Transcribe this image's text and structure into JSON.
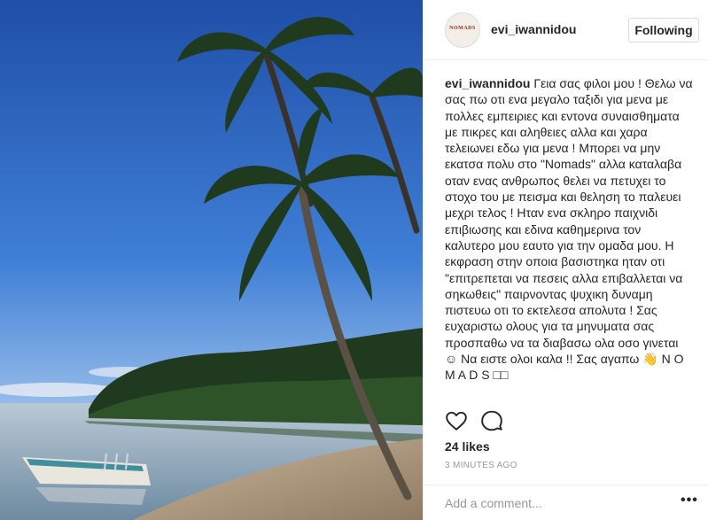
{
  "header": {
    "avatar_text": "NOMADS",
    "username": "evi_iwannidou",
    "follow_label": "Following"
  },
  "caption": {
    "username": "evi_iwannidou",
    "text": "Γεια σας φιλοι μου ! Θελω να σας πω οτι ενα μεγαλο ταξιδι για μενα με πολλες εμπειριες και εντονα συναισθηματα με πικρες και αληθειες αλλα και χαρα τελειωνει εδω για μενα ! Μπορει να μην εκατσα πολυ στο \"Nomads\" αλλα καταλαβα οταν ενας ανθρωπος θελει να πετυχει το στοχο του με πεισμα και θεληση το παλευει μεχρι τελος ! Ηταν ενα σκληρο παιχνιδι επιβιωσης και εδινα καθημερινα τον καλυτερο μου εαυτο για την ομαδα μου. Η εκφραση στην οποια βασιστηκα ηταν οτι \"επιτρεπεται να πεσεις αλλα επιβαλλεται να σηκωθεις\" παιρνοντας ψυχικη δυναμη πιστευω οτι το εκτελεσα απολυτα ! Σας ευχαριστω ολους για τα μηνυματα σας προσπαθω να τα διαβασω ολα οσο γινεται ☺ Να ειστε ολοι καλα !! Σας αγαπω 👋 N O M A D S □□"
  },
  "actions": {
    "like_icon": "heart-outline-icon",
    "comment_icon": "comment-bubble-icon"
  },
  "likes": "24 likes",
  "timestamp": "3 MINUTES AGO",
  "comment": {
    "placeholder": "Add a comment...",
    "more_label": "•••"
  },
  "colors": {
    "sky": "#2b63b8",
    "border": "#efefef",
    "text": "#262626",
    "muted": "#999999"
  }
}
